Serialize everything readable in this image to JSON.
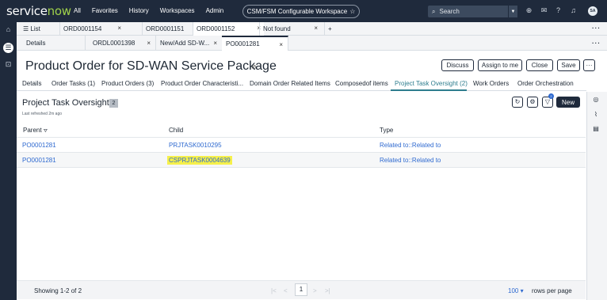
{
  "app": {
    "logo_prefix": "service",
    "logo_suffix": "now",
    "nav": [
      "All",
      "Favorites",
      "History",
      "Workspaces",
      "Admin"
    ],
    "workspace": "CSM/FSM Configurable Workspace",
    "workspace_star": "☆",
    "search_placeholder": "Search",
    "avatar_initials": "SA"
  },
  "tabs_top": [
    {
      "label": "List"
    },
    {
      "label": "ORD0001154"
    },
    {
      "label": "ORD0001151"
    },
    {
      "label": "ORD0001152"
    },
    {
      "label": "Not found"
    }
  ],
  "tabs_sub": [
    {
      "label": "Details"
    },
    {
      "label": "ORDL0001398"
    },
    {
      "label": "New/Add SD-W..."
    },
    {
      "label": "PO0001281"
    }
  ],
  "record": {
    "title": "Product Order for SD-WAN Service Package",
    "buttons": [
      "Discuss",
      "Assign to me",
      "Close",
      "Save",
      "···"
    ]
  },
  "related_tabs": [
    "Details",
    "Order Tasks (1)",
    "Product Orders (3)",
    "Product Order Characteristi...",
    "Domain Order Related Items",
    "Composedof items",
    "Project Task Oversight (2)",
    "Work Orders",
    "Order Orchestration"
  ],
  "list": {
    "title": "Project Task Oversight",
    "count": "2",
    "refreshed": "Last refreshed 2m ago",
    "filter_count": "2",
    "new_label": "New",
    "columns": [
      "Parent",
      "Child",
      "Type"
    ],
    "parent_sort_icon": "⛛",
    "rows": [
      {
        "parent": "PO0001281",
        "child": "PRJTASK0010295",
        "type": "Related to::Related to"
      },
      {
        "parent": "PO0001281",
        "child": "CSPRJTASK0004639",
        "type": "Related to::Related to"
      }
    ],
    "showing": "Showing 1-2 of 2",
    "page": "1",
    "rows_per_page": "100",
    "rows_per_page_label": "rows per page"
  },
  "colors": {
    "nav_bg": "#1f2a3c",
    "link": "#2f6ad0",
    "active_tab": "#2e7d8e",
    "highlight": "#f6f04a"
  }
}
